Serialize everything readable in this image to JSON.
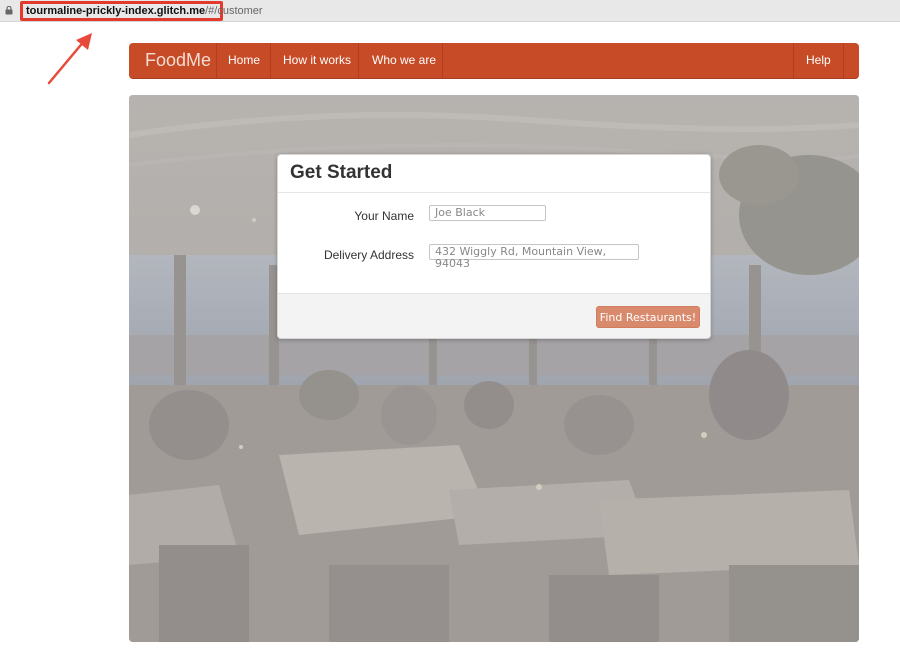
{
  "browser": {
    "url_host": "tourmaline-prickly-index.glitch.me",
    "url_path": "/#/customer",
    "lock_icon": "lock-icon"
  },
  "annotation": {
    "color": "#e23b2d",
    "icon": "red-arrow-icon"
  },
  "navbar": {
    "brand": "FoodMe",
    "items": [
      {
        "label": "Home"
      },
      {
        "label": "How it works"
      },
      {
        "label": "Who we are"
      }
    ],
    "help_label": "Help",
    "color": "#c74b26"
  },
  "form": {
    "title": "Get Started",
    "name_label": "Your Name",
    "name_value": "Joe Black",
    "address_label": "Delivery Address",
    "address_value": "432 Wiggly Rd, Mountain View, 94043",
    "submit_label": "Find Restaurants!",
    "button_color": "#d98a6c"
  }
}
